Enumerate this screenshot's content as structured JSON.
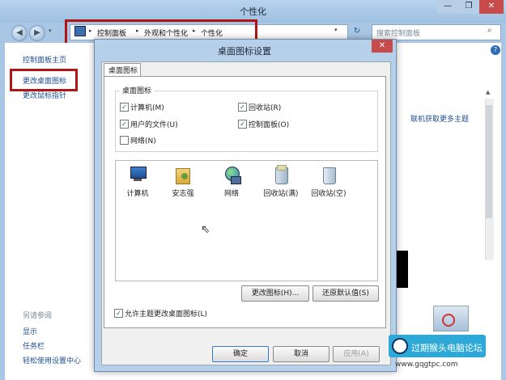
{
  "window": {
    "title": "个性化",
    "min": "—",
    "max": "❐",
    "close": "✕"
  },
  "nav": {
    "back": "◀",
    "forward": "▶",
    "history": "▾",
    "breadcrumb": [
      "控制面板",
      "外观和个性化",
      "个性化"
    ],
    "separator": "▸",
    "dropdown": "▾",
    "refresh": "↻",
    "search_placeholder": "搜索控制面板",
    "search_icon": "⌕"
  },
  "sidebar": {
    "items": [
      "控制面板主页",
      "更改桌面图标",
      "更改鼠标指针"
    ],
    "see_also_title": "另请参阅",
    "see_also": [
      "显示",
      "任务栏",
      "轻松使用设置中心"
    ]
  },
  "main": {
    "help": "?",
    "online_link": "联机获取更多主题"
  },
  "dialog": {
    "title": "桌面图标设置",
    "close": "✕",
    "tab": "桌面图标",
    "group_title": "桌面图标",
    "checkboxes": [
      {
        "label": "计算机(M)",
        "checked": true
      },
      {
        "label": "回收站(R)",
        "checked": true
      },
      {
        "label": "用户的文件(U)",
        "checked": true
      },
      {
        "label": "控制面板(O)",
        "checked": true
      },
      {
        "label": "网络(N)",
        "checked": false
      }
    ],
    "icons": [
      "计算机",
      "安志强",
      "网络",
      "回收站(满)",
      "回收站(空)"
    ],
    "change_icon": "更改图标(H)...",
    "restore_default": "还原默认值(S)",
    "allow_themes": "允许主题更改桌面图标(L)",
    "allow_checked": true,
    "ok": "确定",
    "cancel": "取消",
    "apply": "应用(A)"
  },
  "watermark": {
    "text": "过期猴头电脑论坛",
    "url": "www.gqgtpc.com"
  },
  "colors": {
    "highlight": "#b01616",
    "link": "#1d4f91",
    "chrome": "#a9c7e4"
  }
}
